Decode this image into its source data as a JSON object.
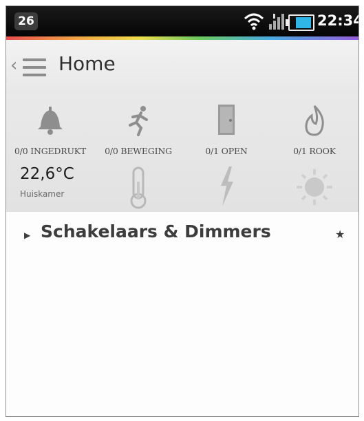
{
  "statusbar": {
    "notification_count": "26",
    "time": "22:34",
    "battery_color": "#30b6e6"
  },
  "actionbar": {
    "title": "Home"
  },
  "sensors": {
    "row1": [
      {
        "icon": "bell-icon",
        "label": "0/0 INGEDRUKT"
      },
      {
        "icon": "running-man-icon",
        "label": "0/0 BEWEGING"
      },
      {
        "icon": "door-icon",
        "label": "0/1 OPEN"
      },
      {
        "icon": "flame-icon",
        "label": "0/1 ROOK"
      }
    ],
    "temperature": {
      "value": "22,6°C",
      "room": "Huiskamer"
    },
    "row2_icons": [
      "thermometer-icon",
      "lightning-icon",
      "sun-icon"
    ]
  },
  "groups": [
    {
      "label": "Schakelaars & Dimmers",
      "favorite_icon": "star-icon"
    }
  ]
}
